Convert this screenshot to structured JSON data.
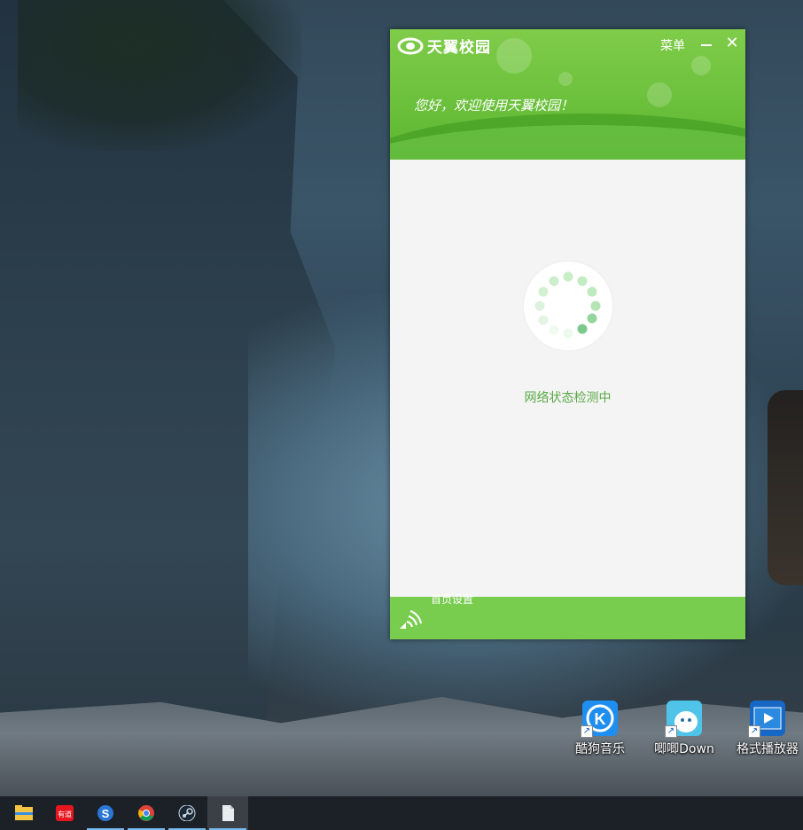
{
  "app": {
    "title": "天翼校园",
    "menu_label": "菜单",
    "close_glyph": "✕",
    "welcome_text": "您好，欢迎使用天翼校园！",
    "status_text": "网络状态检测中",
    "footer_link": "首页设置",
    "accent_color": "#6cc13c",
    "status_color": "#5aaa47"
  },
  "desktop": {
    "icons": [
      {
        "label": "酷狗音乐",
        "icon": "kugou-music-icon"
      },
      {
        "label": "唧唧Down",
        "icon": "jijidown-icon"
      },
      {
        "label": "格式播放器",
        "icon": "format-player-icon"
      }
    ]
  },
  "taskbar": {
    "items": [
      {
        "name": "file-explorer-icon"
      },
      {
        "name": "youdao-dictionary-icon",
        "label": "有道"
      },
      {
        "name": "sogou-browser-icon",
        "label": "S"
      },
      {
        "name": "chrome-icon"
      },
      {
        "name": "steam-icon"
      },
      {
        "name": "document-icon"
      }
    ]
  }
}
